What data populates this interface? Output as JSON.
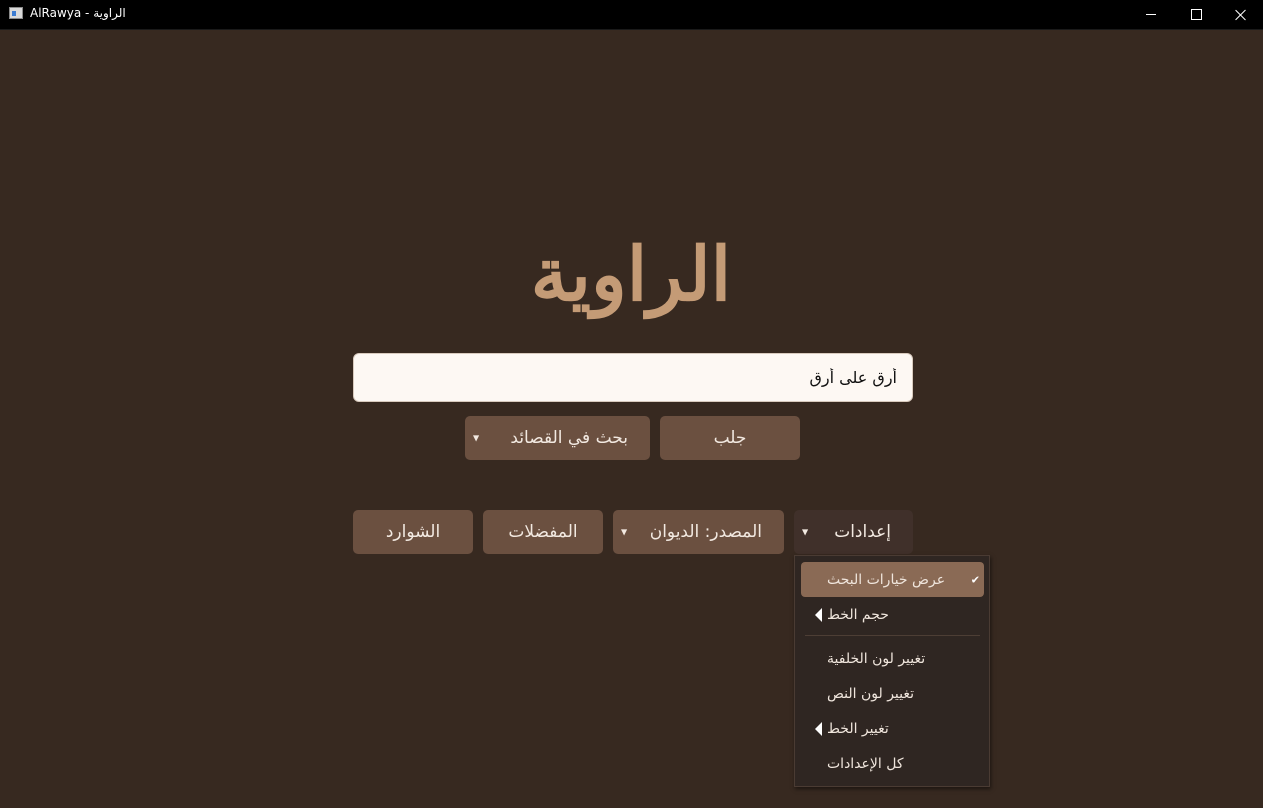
{
  "window": {
    "title": "AlRawya - الراوية"
  },
  "logo": {
    "text": "الراوية"
  },
  "search": {
    "value": "أرق على أرق"
  },
  "actions": {
    "search_poems_label": "بحث في القصائد",
    "fetch_label": "جلب"
  },
  "nav": {
    "shawarid_label": "الشوارد",
    "favorites_label": "المفضلات",
    "source_label": "المصدر: الديوان",
    "settings_label": "إعدادات"
  },
  "settings_menu": {
    "items": [
      {
        "label": "عرض خيارات البحث",
        "checked": true
      },
      {
        "label": "حجم الخط",
        "submenu": true
      },
      {
        "label": "تغيير لون الخلفية"
      },
      {
        "label": "تغيير لون النص"
      },
      {
        "label": "تغيير الخط",
        "submenu": true
      },
      {
        "label": "كل الإعدادات"
      }
    ]
  },
  "icons": {
    "caret": "chevron-down-icon",
    "check": "check-icon",
    "submenu": "submenu-arrow-icon"
  },
  "colors": {
    "background": "#372920",
    "button": "#6b5040",
    "logo": "#c49b76",
    "menu_selected": "#8a6a55"
  }
}
